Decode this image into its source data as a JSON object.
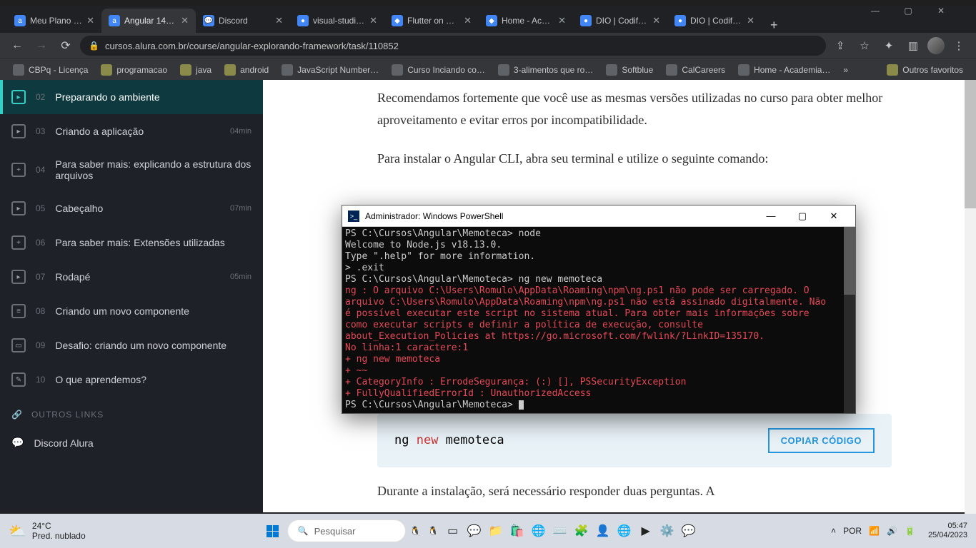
{
  "window": {
    "min": "—",
    "max": "▢",
    "close": "✕"
  },
  "tabs": [
    {
      "label": "Meu Plano d…",
      "fav": "a"
    },
    {
      "label": "Angular 14: …",
      "fav": "a",
      "active": true
    },
    {
      "label": "Discord",
      "fav": "💬"
    },
    {
      "label": "visual-studio…",
      "fav": "●"
    },
    {
      "label": "Flutter on M…",
      "fav": "◆"
    },
    {
      "label": "Home - Acad…",
      "fav": "◆"
    },
    {
      "label": "DIO | Codific…",
      "fav": "●"
    },
    {
      "label": "DIO | Codific…",
      "fav": "●"
    }
  ],
  "url": "cursos.alura.com.br/course/angular-explorando-framework/task/110852",
  "bookmarks": [
    {
      "label": "CBPq - Licença",
      "folder": false
    },
    {
      "label": "programacao",
      "folder": true
    },
    {
      "label": "java",
      "folder": true
    },
    {
      "label": "android",
      "folder": true
    },
    {
      "label": "JavaScript Number…",
      "folder": false
    },
    {
      "label": "Curso Inciando co…",
      "folder": false
    },
    {
      "label": "3-alimentos que ro…",
      "folder": false
    },
    {
      "label": "Softblue",
      "folder": false
    },
    {
      "label": "CalCareers",
      "folder": false
    },
    {
      "label": "Home - Academia…",
      "folder": false
    }
  ],
  "bmmore": "»",
  "bmother": "Outros favoritos",
  "sidebar": {
    "items": [
      {
        "num": "02",
        "label": "Preparando o ambiente",
        "dur": "",
        "active": true,
        "icon": "▸"
      },
      {
        "num": "03",
        "label": "Criando a aplicação",
        "dur": "04min",
        "icon": "▸"
      },
      {
        "num": "04",
        "label": "Para saber mais: explicando a estrutura dos arquivos",
        "dur": "",
        "icon": "+"
      },
      {
        "num": "05",
        "label": "Cabeçalho",
        "dur": "07min",
        "icon": "▸"
      },
      {
        "num": "06",
        "label": "Para saber mais: Extensões utilizadas",
        "dur": "",
        "icon": "+"
      },
      {
        "num": "07",
        "label": "Rodapé",
        "dur": "05min",
        "icon": "▸"
      },
      {
        "num": "08",
        "label": "Criando um novo componente",
        "dur": "",
        "icon": "≡"
      },
      {
        "num": "09",
        "label": "Desafio: criando um novo componente",
        "dur": "",
        "icon": "▭"
      },
      {
        "num": "10",
        "label": "O que aprendemos?",
        "dur": "",
        "icon": "✎"
      }
    ],
    "section": "OUTROS LINKS",
    "discord": "Discord Alura"
  },
  "article": {
    "p1": "Recomendamos fortemente que você use as mesmas versões utilizadas no curso para obter melhor aproveitamento e evitar erros por incompatibilidade.",
    "p2": "Para instalar o Angular CLI, abra seu terminal e utilize o seguinte comando:",
    "code_pre": "ng ",
    "code_kw": "new",
    "code_post": " memoteca",
    "copy": "COPIAR CÓDIGO",
    "p3": "Durante a instalação, será necessário responder duas perguntas. A"
  },
  "ps": {
    "title": "Administrador: Windows PowerShell",
    "lines": [
      {
        "t": "PS C:\\Cursos\\Angular\\Memoteca> node"
      },
      {
        "t": "Welcome to Node.js v18.13.0."
      },
      {
        "t": "Type \".help\" for more information."
      },
      {
        "t": "> .exit"
      },
      {
        "t": "PS C:\\Cursos\\Angular\\Memoteca> ng new memoteca"
      },
      {
        "t": "ng : O arquivo C:\\Users\\Romulo\\AppData\\Roaming\\npm\\ng.ps1 não pode ser carregado. O",
        "err": true
      },
      {
        "t": "arquivo C:\\Users\\Romulo\\AppData\\Roaming\\npm\\ng.ps1 não está assinado digitalmente. Não",
        "err": true
      },
      {
        "t": "é possível executar este script no sistema atual. Para obter mais informações sobre",
        "err": true
      },
      {
        "t": "como executar scripts e definir a política de execução, consulte",
        "err": true
      },
      {
        "t": "about_Execution_Policies at https://go.microsoft.com/fwlink/?LinkID=135170.",
        "err": true
      },
      {
        "t": "No linha:1 caractere:1",
        "err": true
      },
      {
        "t": "+ ng new memoteca",
        "err": true
      },
      {
        "t": "+ ~~",
        "err": true
      },
      {
        "t": "    + CategoryInfo          : ErrodeSegurança: (:) [], PSSecurityException",
        "err": true
      },
      {
        "t": "    + FullyQualifiedErrorId : UnauthorizedAccess",
        "err": true
      },
      {
        "t": "PS C:\\Cursos\\Angular\\Memoteca> ",
        "cursor": true
      }
    ]
  },
  "taskbar": {
    "temp": "24°C",
    "weather": "Pred. nublado",
    "search": "Pesquisar",
    "lang": "POR",
    "time": "05:47",
    "date": "25/04/2023",
    "iconsA": [
      "🐧",
      "🐧"
    ],
    "icons": [
      "▭",
      "💬",
      "📁",
      "🛍️",
      "🌐",
      "⌨️",
      "🧩",
      "👤",
      "🌐",
      "▶",
      "⚙️",
      "💬"
    ]
  }
}
